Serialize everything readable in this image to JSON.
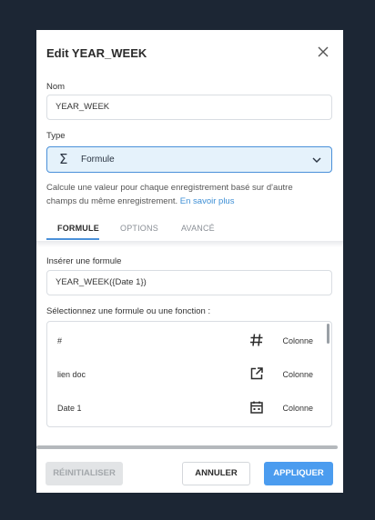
{
  "dialog": {
    "title": "Edit YEAR_WEEK",
    "name_label": "Nom",
    "name_value": "YEAR_WEEK",
    "type_label": "Type",
    "type_value": "Formule",
    "type_icon": "sigma-icon",
    "description": "Calcule une valeur pour chaque enregistrement basé sur d'autre champs du même enregistrement.",
    "learn_more": "En savoir plus"
  },
  "tabs": [
    {
      "label": "FORMULE",
      "active": true
    },
    {
      "label": "OPTIONS",
      "active": false
    },
    {
      "label": "AVANCÉ",
      "active": false
    }
  ],
  "formula": {
    "insert_label": "Insérer une formule",
    "value": "YEAR_WEEK({Date 1})",
    "select_label": "Sélectionnez une formule ou une fonction :",
    "items": [
      {
        "name": "#",
        "icon": "hash-icon",
        "kind": "Colonne"
      },
      {
        "name": "lien doc",
        "icon": "external-link-icon",
        "kind": "Colonne"
      },
      {
        "name": "Date 1",
        "icon": "calendar-icon",
        "kind": "Colonne"
      }
    ]
  },
  "buttons": {
    "reset": "RÉINITIALISER",
    "cancel": "ANNULER",
    "apply": "APPLIQUER"
  },
  "colors": {
    "page_bg": "#1c2634",
    "accent": "#4a90d9",
    "apply_bg": "#4b9cef",
    "select_bg": "#e5f2fb"
  }
}
